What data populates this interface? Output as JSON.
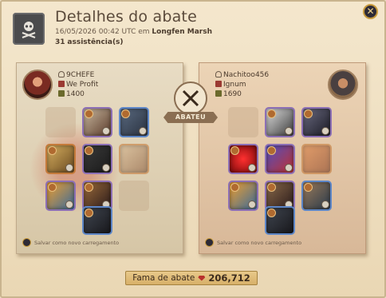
{
  "header": {
    "title": "Detalhes do abate",
    "datetime": "16/05/2026 00:42 UTC em",
    "location": "Longfen Marsh",
    "assists_count": "31",
    "assists_label": "assistência(s)"
  },
  "killer": {
    "name": "9CHEFE",
    "guild": "We Profit",
    "item_power": "1400",
    "save_label": "Salvar como novo carregamento"
  },
  "victim": {
    "name": "Nachitoo456",
    "guild": "Ignum",
    "item_power": "1690",
    "save_label": "Salvar como novo carregamento"
  },
  "center": {
    "label": "ABATEU"
  },
  "fame": {
    "label": "Fama de abate",
    "value": "206,712"
  },
  "colors": {
    "accent": "#8a6e52",
    "fame_gem": "#b8302c",
    "rare_border": "#8c6fb5"
  },
  "icons": {
    "header": "skull-crossbones-icon",
    "center": "crossed-swords-icon",
    "close": "close-icon"
  }
}
